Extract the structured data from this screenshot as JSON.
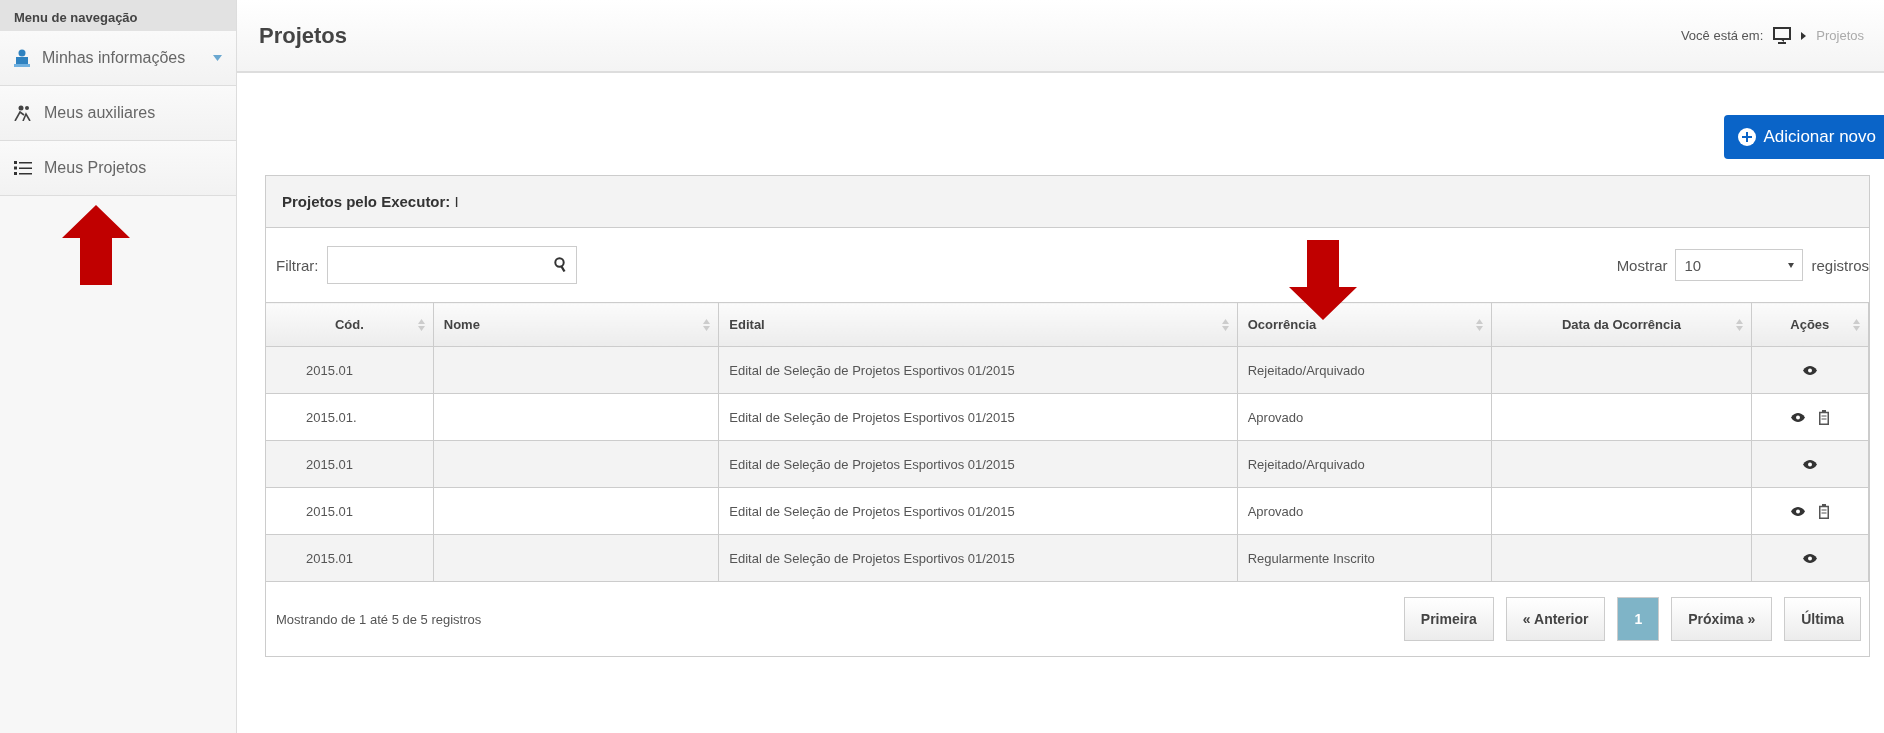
{
  "sidebar": {
    "title": "Menu de navegação",
    "items": [
      {
        "label": "Minhas informações",
        "kind": "dropdown"
      },
      {
        "label": "Meus auxiliares",
        "kind": "link"
      },
      {
        "label": "Meus Projetos",
        "kind": "link"
      }
    ]
  },
  "header": {
    "title": "Projetos",
    "breadcrumb_label": "Você está em:",
    "breadcrumb_current": "Projetos"
  },
  "add_button": "Adicionar novo",
  "panel": {
    "title": "**Projetos pelo Executor:** I",
    "filter_label": "Filtrar:",
    "show_label": "Mostrar",
    "show_value": "10",
    "records_label": "registros",
    "table": {
      "columns": [
        "Cód.",
        "Nome",
        "Edital",
        "Ocorrência",
        "Data da Ocorrência",
        "Ações"
      ],
      "rows": [
        {
          "code": "2015.01",
          "edital": "Edital de Seleção de Projetos Esportivos 01/2015",
          "ocorrencia": "Rejeitado/Arquivado",
          "deletable": false
        },
        {
          "code": "2015.01.",
          "edital": "Edital de Seleção de Projetos Esportivos 01/2015",
          "ocorrencia": "Aprovado",
          "deletable": true
        },
        {
          "code": "2015.01",
          "edital": "Edital de Seleção de Projetos Esportivos 01/2015",
          "ocorrencia": "Rejeitado/Arquivado",
          "deletable": false
        },
        {
          "code": "2015.01",
          "edital": "Edital de Seleção de Projetos Esportivos 01/2015",
          "ocorrencia": "Aprovado",
          "deletable": true
        },
        {
          "code": "2015.01",
          "edital": "Edital de Seleção de Projetos Esportivos 01/2015",
          "ocorrencia": "Regularmente Inscrito",
          "deletable": false
        }
      ]
    },
    "summary": "Mostrando de 1 até 5 de 5 registros",
    "pagination": [
      {
        "label": "Primeira",
        "selected": false
      },
      {
        "label": "« Anterior",
        "selected": false
      },
      {
        "label": "1",
        "selected": true
      },
      {
        "label": "Próxima »",
        "selected": false
      },
      {
        "label": "Última",
        "selected": false
      }
    ]
  }
}
